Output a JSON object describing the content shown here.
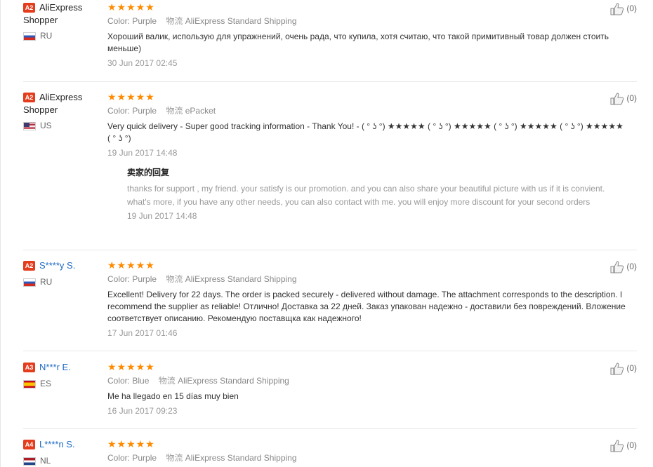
{
  "reviews": [
    {
      "badge": "A2",
      "name": "AliExpress Shopper",
      "country": "RU",
      "stars": "★★★★★",
      "color_label": "Color:",
      "color": "Purple",
      "ship_label": "物流",
      "shipping": "AliExpress Standard Shipping",
      "text": "Хороший валик, использую для упражнений, очень рада, что купила, хотя считаю, что такой примитивный товар должен стоить меньше)",
      "date": "30 Jun 2017 02:45",
      "likes": "(0)"
    },
    {
      "badge": "A2",
      "name": "AliExpress Shopper",
      "country": "US",
      "stars": "★★★★★",
      "color_label": "Color:",
      "color": "Purple",
      "ship_label": "物流",
      "shipping": "ePacket",
      "text": "Very quick delivery - Super good tracking information - Thank You! - ( ° ʖ °) ★★★★★ ( ° ʖ °) ★★★★★ ( ° ʖ °) ★★★★★ ( ° ʖ °) ★★★★★ ( ° ʖ °)",
      "date": "19 Jun 2017 14:48",
      "reply_title": "卖家的回复",
      "reply_text": "thanks for support , my friend. your satisfy is our promotion. and you can also share your beautiful picture with us if it is convient. what's more, if you have any other needs, you can also contact with me. you will enjoy more discount for your second orders",
      "reply_date": "19 Jun 2017 14:48",
      "likes": "(0)"
    },
    {
      "badge": "A2",
      "name": "S****y S.",
      "country": "RU",
      "stars": "★★★★★",
      "color_label": "Color:",
      "color": "Purple",
      "ship_label": "物流",
      "shipping": "AliExpress Standard Shipping",
      "text": "Excellent! Delivery for 22 days. The order is packed securely - delivered without damage. The attachment corresponds to the description. I recommend the supplier as reliable! Отлично! Доставка за 22 дней. Заказ упакован надежно - доставили без повреждений. Вложение соответствует описанию. Рекомендую поставщка как надежного!",
      "date": "17 Jun 2017 01:46",
      "likes": "(0)"
    },
    {
      "badge": "A3",
      "name": "N***r E.",
      "country": "ES",
      "stars": "★★★★★",
      "color_label": "Color:",
      "color": "Blue",
      "ship_label": "物流",
      "shipping": "AliExpress Standard Shipping",
      "text": "Me ha llegado en 15 días muy bien",
      "date": "16 Jun 2017 09:23",
      "likes": "(0)"
    },
    {
      "badge": "A4",
      "name": "L****n S.",
      "country": "NL",
      "stars": "★★★★★",
      "color_label": "Color:",
      "color": "Purple",
      "ship_label": "物流",
      "shipping": "AliExpress Standard Shipping",
      "likes": "(0)"
    }
  ]
}
